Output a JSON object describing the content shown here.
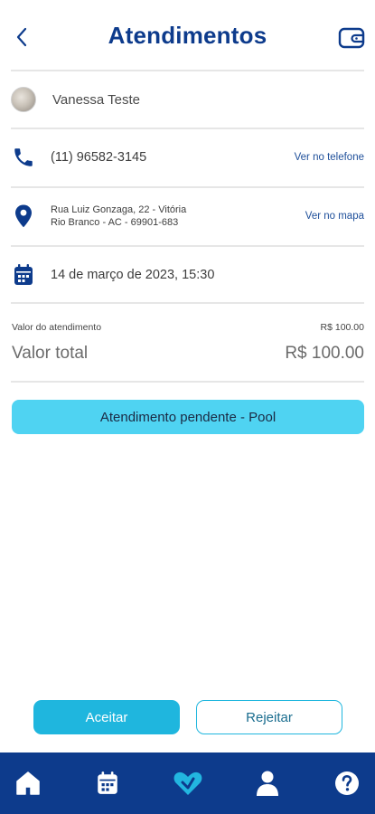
{
  "header": {
    "title": "Atendimentos"
  },
  "client": {
    "name": "Vanessa Teste"
  },
  "phone": {
    "number": "(11) 96582-3145",
    "link": "Ver no telefone"
  },
  "address": {
    "line1": "Rua Luiz Gonzaga, 22 - Vitória",
    "line2": "Rio Branco - AC - 69901-683",
    "link": "Ver no mapa"
  },
  "schedule": {
    "datetime": "14 de março de 2023, 15:30"
  },
  "values": {
    "service_label": "Valor do atendimento",
    "service_amount": "R$ 100.00",
    "total_label": "Valor total",
    "total_amount": "R$ 100.00"
  },
  "status": {
    "label": "Atendimento pendente - Pool"
  },
  "actions": {
    "accept": "Aceitar",
    "reject": "Rejeitar"
  },
  "nav": {
    "items": [
      "home-icon",
      "calendar-icon",
      "heart-icon",
      "person-icon",
      "help-icon"
    ]
  },
  "colors": {
    "primary": "#0d3b8c",
    "accent": "#1fb6de",
    "status_pill": "#4fd3f2"
  }
}
